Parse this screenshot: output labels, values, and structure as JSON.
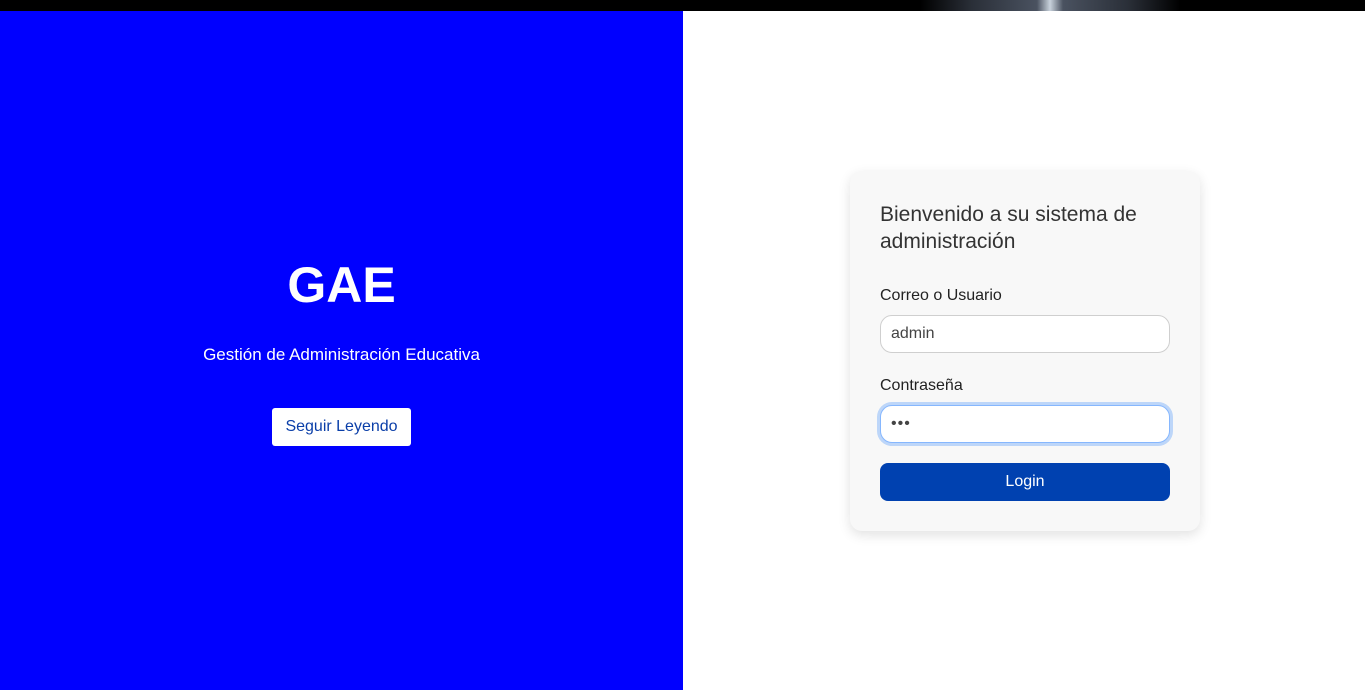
{
  "brand": {
    "title": "GAE",
    "subtitle": "Gestión de Administración Educativa",
    "read_more_label": "Seguir Leyendo"
  },
  "login": {
    "heading": "Bienvenido a su sistema de administración",
    "user_label": "Correo o Usuario",
    "user_value": "admin",
    "password_label": "Contraseña",
    "password_value": "abc",
    "submit_label": "Login"
  },
  "colors": {
    "left_panel_bg": "#0000ff",
    "login_button_bg": "#0041b0",
    "card_bg": "#f8f8f8"
  }
}
